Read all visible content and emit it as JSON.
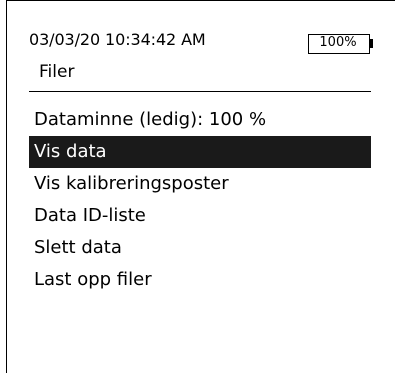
{
  "status_bar": {
    "datetime": "03/03/20 10:34:42 AM",
    "battery_level": "100%"
  },
  "screen": {
    "title": "Filer"
  },
  "menu": {
    "selected_index": 1,
    "items": [
      {
        "label": "Dataminne (ledig): 100 %"
      },
      {
        "label": "Vis data"
      },
      {
        "label": "Vis kalibreringsposter"
      },
      {
        "label": "Data ID-liste"
      },
      {
        "label": "Slett data"
      },
      {
        "label": "Last opp filer"
      }
    ]
  },
  "colors": {
    "background": "#ffffff",
    "foreground": "#000000",
    "selection_background": "#1a1a1a",
    "selection_text": "#ffffff"
  }
}
